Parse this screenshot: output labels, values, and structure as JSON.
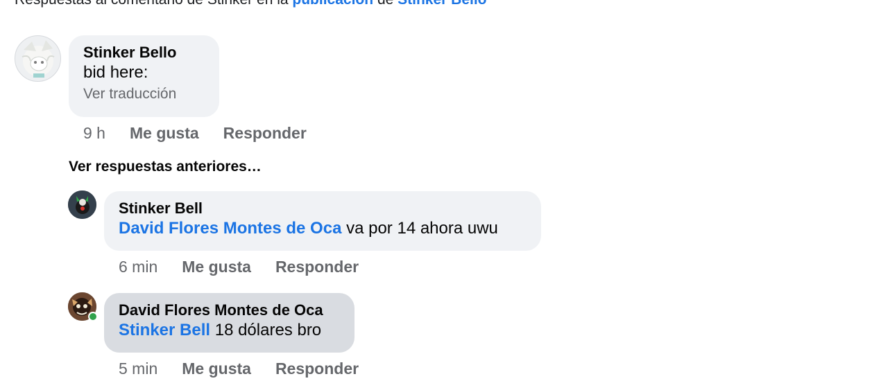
{
  "header": {
    "prefix": "Respuestas al comentario de Stinker en la",
    "post_link": "publicación",
    "connector": "de",
    "page_link": "Stinker Bello"
  },
  "comments": [
    {
      "author": "Stinker Bello",
      "text": "bid here:",
      "translate": "Ver traducción",
      "time": "9 h",
      "like": "Me gusta",
      "reply": "Responder"
    }
  ],
  "more_replies": "Ver respuestas anteriores…",
  "replies": [
    {
      "author": "Stinker Bell",
      "mention": "David Flores Montes de Oca",
      "text": "va por 14 ahora uwu",
      "time": "6 min",
      "like": "Me gusta",
      "reply": "Responder"
    },
    {
      "author": "David Flores Montes de Oca",
      "mention": "Stinker Bell",
      "text": "18 dólares bro",
      "time": "5 min",
      "like": "Me gusta",
      "reply": "Responder",
      "online": true
    }
  ],
  "colors": {
    "link": "#1b74e4",
    "bubble": "#f0f2f5",
    "bubble_highlight": "#d9dce1",
    "muted": "#65676b",
    "online": "#31a24c"
  }
}
